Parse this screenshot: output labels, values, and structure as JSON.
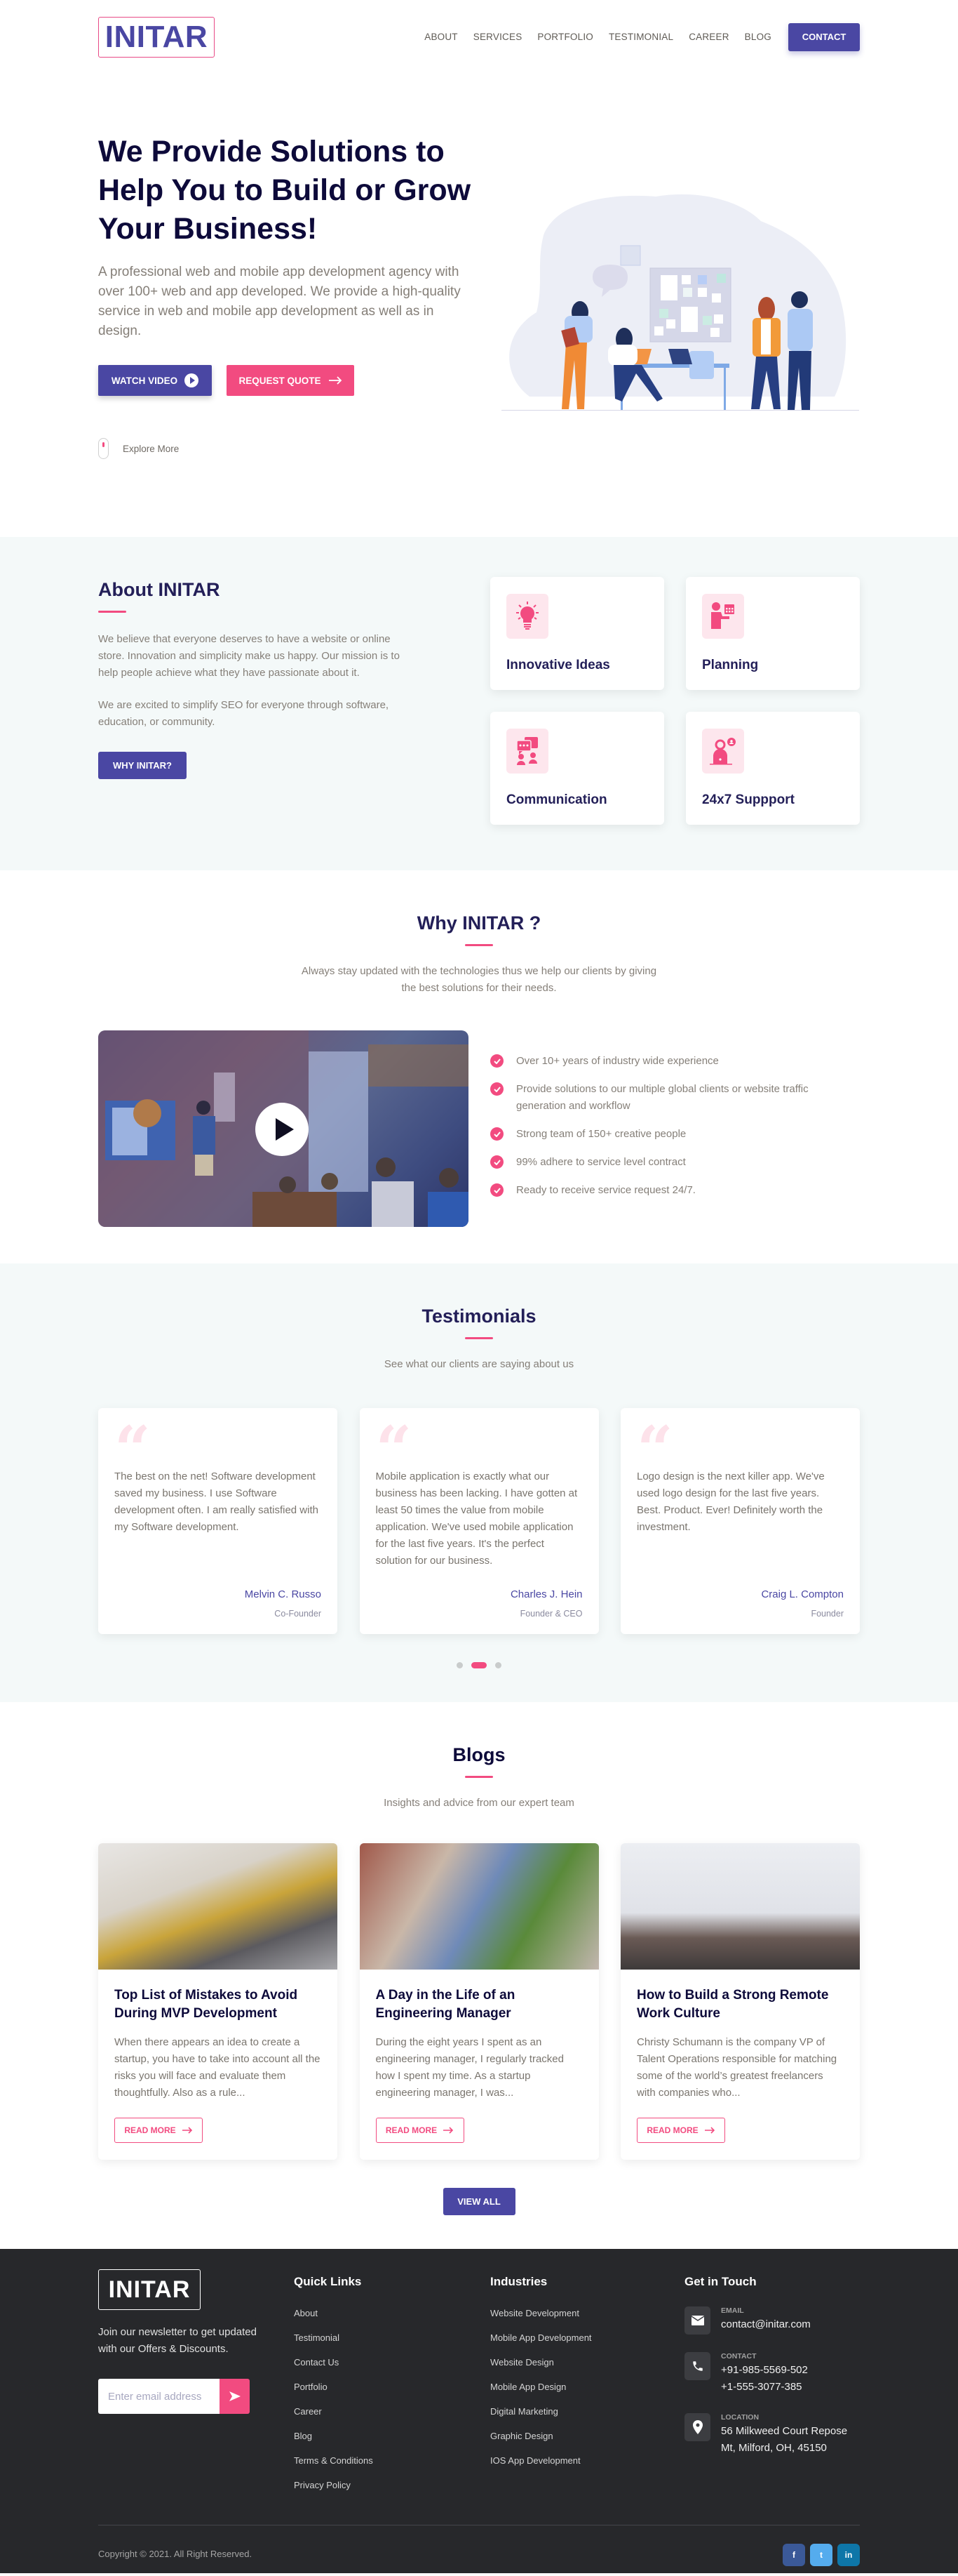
{
  "brand": {
    "name": "INITAR",
    "colors": {
      "primary": "#4a47a3",
      "accent": "#f24b80",
      "heading": "#231f58",
      "footer_bg": "#27282b",
      "section_bg": "#f4f9f9"
    }
  },
  "nav": {
    "items": [
      "ABOUT",
      "SERVICES",
      "PORTFOLIO",
      "TESTIMONIAL",
      "CAREER",
      "BLOG"
    ],
    "contact_label": "CONTACT"
  },
  "hero": {
    "title": "We Provide Solutions to Help You to Build or Grow Your Business!",
    "description": "A professional web and mobile app development agency with over 100+ web and app developed. We provide a high-quality service in web and mobile app development as well as in design.",
    "watch_video_label": "WATCH VIDEO",
    "request_quote_label": "REQUEST QUOTE",
    "explore_label": "Explore More",
    "illustration": "team-meeting-illustration"
  },
  "about": {
    "title": "About INITAR",
    "paragraphs": [
      "We believe that everyone deserves to have a website or online store. Innovation and simplicity make us happy. Our mission is to help people achieve what they have passionate about it.",
      "We are excited to simplify SEO for everyone through software, education, or community."
    ],
    "button_label": "WHY INITAR?",
    "features": [
      {
        "title": "Innovative Ideas",
        "icon": "lightbulb-icon"
      },
      {
        "title": "Planning",
        "icon": "planning-icon"
      },
      {
        "title": "Communication",
        "icon": "communication-icon"
      },
      {
        "title": "24x7 Suppport",
        "icon": "support-icon"
      }
    ]
  },
  "why": {
    "title": "Why INITAR ?",
    "subtitle": "Always stay updated with the technologies thus we help our clients by giving the best solutions for their needs.",
    "points": [
      "Over 10+ years of industry wide experience",
      "Provide solutions to our multiple global clients or website traffic generation and workflow",
      "Strong team of 150+ creative people",
      "99% adhere to service level contract",
      "Ready to receive service request 24/7."
    ]
  },
  "testimonials": {
    "title": "Testimonials",
    "subtitle": "See what our clients are saying about us",
    "items": [
      {
        "text": "The best on the net! Software development saved my business. I use Software development often. I am really satisfied with my Software development.",
        "name": "Melvin C. Russo",
        "role": "Co-Founder"
      },
      {
        "text": "Mobile application is exactly what our business has been lacking. I have gotten at least 50 times the value from mobile application. We've used mobile application for the last five years. It's the perfect solution for our business.",
        "name": "Charles J. Hein",
        "role": "Founder & CEO"
      },
      {
        "text": "Logo design is the next killer app. We've used logo design for the last five years. Best. Product. Ever! Definitely worth the investment.",
        "name": "Craig L. Compton",
        "role": "Founder"
      }
    ],
    "pagination": {
      "total": 3,
      "active": 2
    }
  },
  "blogs": {
    "title": "Blogs",
    "subtitle": "Insights and advice from our expert team",
    "items": [
      {
        "title": "Top List of Mistakes to Avoid During MVP Development",
        "excerpt": "When there appears an idea to create a startup, you have to take into account all the risks you will face and evaluate them thoughtfully. Also as a rule...",
        "cta": "READ MORE"
      },
      {
        "title": "A Day in the Life of an Engineering Manager",
        "excerpt": "During the eight years I spent as an engineering manager, I regularly tracked how I spent my time. As a startup engineering manager, I was...",
        "cta": "READ MORE"
      },
      {
        "title": "How to Build a Strong Remote Work Culture",
        "excerpt": "Christy Schumann is the company VP of Talent Operations responsible for matching some of the world’s greatest freelancers with companies who...",
        "cta": "READ MORE"
      }
    ],
    "view_all_label": "VIEW ALL"
  },
  "footer": {
    "logo": "INITAR",
    "newsletter_text": "Join our newsletter to get updated with our Offers & Discounts.",
    "email_placeholder": "Enter email address",
    "quick_links": {
      "title": "Quick Links",
      "items": [
        "About",
        "Testimonial",
        "Contact Us",
        "Portfolio",
        "Career",
        "Blog",
        "Terms & Conditions",
        "Privacy Policy"
      ]
    },
    "industries": {
      "title": "Industries",
      "items": [
        "Website Development",
        "Mobile App Development",
        "Website Design",
        "Mobile App Design",
        "Digital Marketing",
        "Graphic Design",
        "IOS App Development"
      ]
    },
    "contact": {
      "title": "Get in Touch",
      "email_label": "EMAIL",
      "email": "contact@initar.com",
      "phone_label": "CONTACT",
      "phones": [
        "+91-985-5569-502",
        "+1-555-3077-385"
      ],
      "location_label": "LOCATION",
      "address": [
        "56 Milkweed Court Repose",
        "Mt, Milford, OH, 45150"
      ]
    },
    "copyright": "Copyright © 2021. All Right Reserved.",
    "social": [
      {
        "name": "facebook",
        "glyph": "f",
        "color": "#3b5998"
      },
      {
        "name": "twitter",
        "glyph": "t",
        "color": "#55acee"
      },
      {
        "name": "linkedin",
        "glyph": "in",
        "color": "#0e76a8"
      }
    ]
  }
}
